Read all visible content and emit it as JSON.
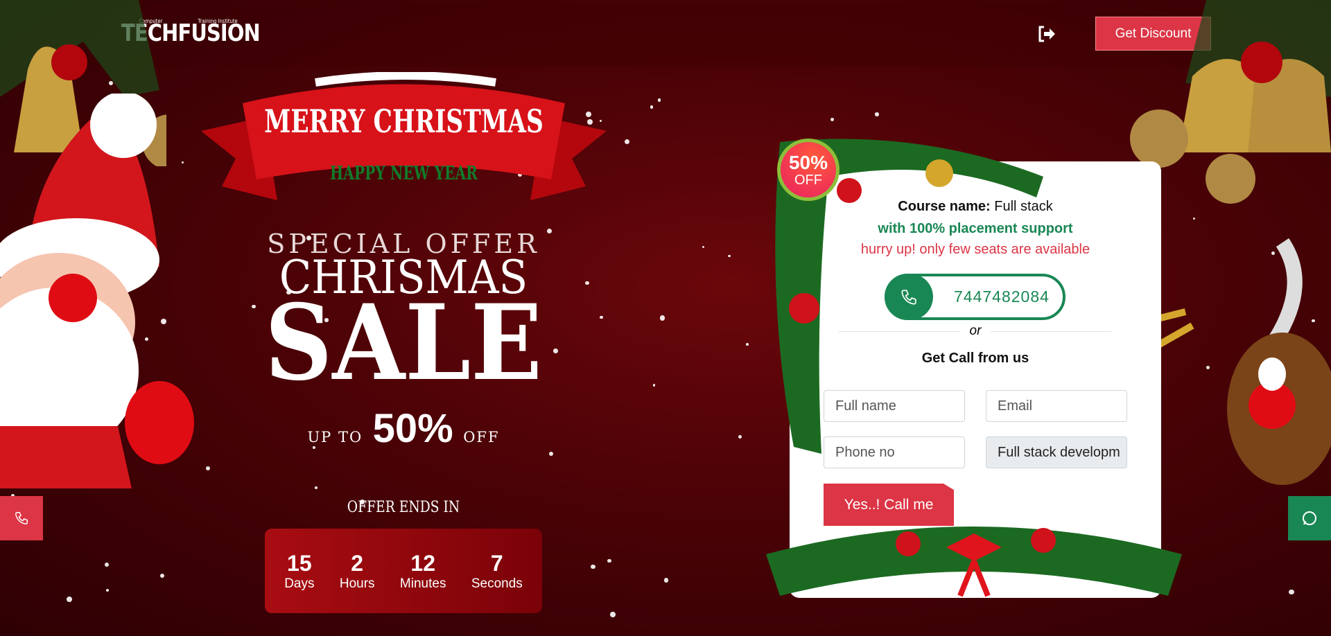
{
  "header": {
    "logo_main": "TECHFUSION",
    "logo_small_left": "Computer",
    "logo_small_right": "Training Institute",
    "discount_button": "Get Discount",
    "logout_icon": "sign-out-icon"
  },
  "hero": {
    "ribbon_top": "MERRY CHRISTMAS",
    "ribbon_bottom": "HAPPY NEW YEAR",
    "special_offer": "SPECIAL OFFER",
    "chrismas": "CHRISMAS",
    "sale": "SALE",
    "up_to": "UP TO",
    "percent": "50%",
    "off": "OFF",
    "offer_ends": "OFFER ENDS IN"
  },
  "countdown": [
    {
      "value": "15",
      "label": "Days"
    },
    {
      "value": "2",
      "label": "Hours"
    },
    {
      "value": "12",
      "label": "Minutes"
    },
    {
      "value": "7",
      "label": "Seconds"
    }
  ],
  "card": {
    "badge_percent": "50%",
    "badge_off": "OFF",
    "course_label": "Course name:",
    "course_value": "Full stack",
    "placement": "with 100% placement support",
    "hurry": "hurry up! only few seats are available",
    "phone": "7447482084",
    "or": "or",
    "get_call": "Get Call from us",
    "fields": {
      "full_name": "Full name",
      "email": "Email",
      "phone": "Phone no",
      "course": "Full stack developm"
    },
    "submit": "Yes..! Call me"
  },
  "colors": {
    "brand_red": "#dc3545",
    "green": "#198754",
    "bg": "#4a0206"
  }
}
